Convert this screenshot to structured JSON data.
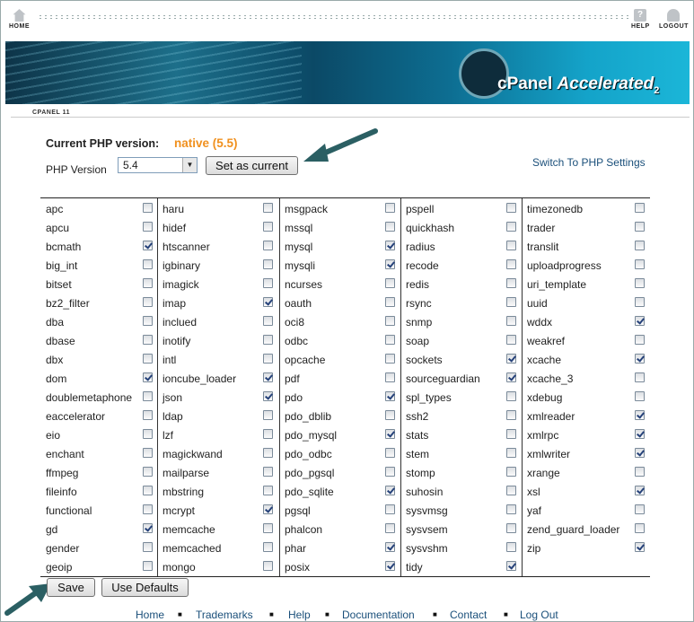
{
  "topbar": {
    "home": "HOME",
    "help": "HELP",
    "logout": "LOGOUT"
  },
  "banner": {
    "logo_cp": "cPanel",
    "logo_acc": "Accelerated",
    "logo_num": "2"
  },
  "breadcrumb": "CPANEL 11",
  "php": {
    "current_label": "Current PHP version:",
    "current_value": "native (5.5)",
    "version_label": "PHP Version",
    "version_selected": "5.4",
    "set_current_button": "Set as current",
    "switch_link": "Switch To PHP Settings"
  },
  "extensions": [
    [
      {
        "name": "apc",
        "checked": false
      },
      {
        "name": "apcu",
        "checked": false
      },
      {
        "name": "bcmath",
        "checked": true
      },
      {
        "name": "big_int",
        "checked": false
      },
      {
        "name": "bitset",
        "checked": false
      },
      {
        "name": "bz2_filter",
        "checked": false
      },
      {
        "name": "dba",
        "checked": false
      },
      {
        "name": "dbase",
        "checked": false
      },
      {
        "name": "dbx",
        "checked": false
      },
      {
        "name": "dom",
        "checked": true
      },
      {
        "name": "doublemetaphone",
        "checked": false
      },
      {
        "name": "eaccelerator",
        "checked": false
      },
      {
        "name": "eio",
        "checked": false
      },
      {
        "name": "enchant",
        "checked": false
      },
      {
        "name": "ffmpeg",
        "checked": false
      },
      {
        "name": "fileinfo",
        "checked": false
      },
      {
        "name": "functional",
        "checked": false
      },
      {
        "name": "gd",
        "checked": true
      },
      {
        "name": "gender",
        "checked": false
      },
      {
        "name": "geoip",
        "checked": false
      }
    ],
    [
      {
        "name": "haru",
        "checked": false
      },
      {
        "name": "hidef",
        "checked": false
      },
      {
        "name": "htscanner",
        "checked": false
      },
      {
        "name": "igbinary",
        "checked": false
      },
      {
        "name": "imagick",
        "checked": false
      },
      {
        "name": "imap",
        "checked": true
      },
      {
        "name": "inclued",
        "checked": false
      },
      {
        "name": "inotify",
        "checked": false
      },
      {
        "name": "intl",
        "checked": false
      },
      {
        "name": "ioncube_loader",
        "checked": true
      },
      {
        "name": "json",
        "checked": true
      },
      {
        "name": "ldap",
        "checked": false
      },
      {
        "name": "lzf",
        "checked": false
      },
      {
        "name": "magickwand",
        "checked": false
      },
      {
        "name": "mailparse",
        "checked": false
      },
      {
        "name": "mbstring",
        "checked": false
      },
      {
        "name": "mcrypt",
        "checked": true
      },
      {
        "name": "memcache",
        "checked": false
      },
      {
        "name": "memcached",
        "checked": false
      },
      {
        "name": "mongo",
        "checked": false
      }
    ],
    [
      {
        "name": "msgpack",
        "checked": false
      },
      {
        "name": "mssql",
        "checked": false
      },
      {
        "name": "mysql",
        "checked": true
      },
      {
        "name": "mysqli",
        "checked": true
      },
      {
        "name": "ncurses",
        "checked": false
      },
      {
        "name": "oauth",
        "checked": false
      },
      {
        "name": "oci8",
        "checked": false
      },
      {
        "name": "odbc",
        "checked": false
      },
      {
        "name": "opcache",
        "checked": false
      },
      {
        "name": "pdf",
        "checked": false
      },
      {
        "name": "pdo",
        "checked": true
      },
      {
        "name": "pdo_dblib",
        "checked": false
      },
      {
        "name": "pdo_mysql",
        "checked": true
      },
      {
        "name": "pdo_odbc",
        "checked": false
      },
      {
        "name": "pdo_pgsql",
        "checked": false
      },
      {
        "name": "pdo_sqlite",
        "checked": true
      },
      {
        "name": "pgsql",
        "checked": false
      },
      {
        "name": "phalcon",
        "checked": false
      },
      {
        "name": "phar",
        "checked": true
      },
      {
        "name": "posix",
        "checked": true
      }
    ],
    [
      {
        "name": "pspell",
        "checked": false
      },
      {
        "name": "quickhash",
        "checked": false
      },
      {
        "name": "radius",
        "checked": false
      },
      {
        "name": "recode",
        "checked": false
      },
      {
        "name": "redis",
        "checked": false
      },
      {
        "name": "rsync",
        "checked": false
      },
      {
        "name": "snmp",
        "checked": false
      },
      {
        "name": "soap",
        "checked": false
      },
      {
        "name": "sockets",
        "checked": true
      },
      {
        "name": "sourceguardian",
        "checked": true
      },
      {
        "name": "spl_types",
        "checked": false
      },
      {
        "name": "ssh2",
        "checked": false
      },
      {
        "name": "stats",
        "checked": false
      },
      {
        "name": "stem",
        "checked": false
      },
      {
        "name": "stomp",
        "checked": false
      },
      {
        "name": "suhosin",
        "checked": false
      },
      {
        "name": "sysvmsg",
        "checked": false
      },
      {
        "name": "sysvsem",
        "checked": false
      },
      {
        "name": "sysvshm",
        "checked": false
      },
      {
        "name": "tidy",
        "checked": true
      }
    ],
    [
      {
        "name": "timezonedb",
        "checked": false
      },
      {
        "name": "trader",
        "checked": false
      },
      {
        "name": "translit",
        "checked": false
      },
      {
        "name": "uploadprogress",
        "checked": false
      },
      {
        "name": "uri_template",
        "checked": false
      },
      {
        "name": "uuid",
        "checked": false
      },
      {
        "name": "wddx",
        "checked": true
      },
      {
        "name": "weakref",
        "checked": false
      },
      {
        "name": "xcache",
        "checked": true
      },
      {
        "name": "xcache_3",
        "checked": false
      },
      {
        "name": "xdebug",
        "checked": false
      },
      {
        "name": "xmlreader",
        "checked": true
      },
      {
        "name": "xmlrpc",
        "checked": true
      },
      {
        "name": "xmlwriter",
        "checked": true
      },
      {
        "name": "xrange",
        "checked": false
      },
      {
        "name": "xsl",
        "checked": true
      },
      {
        "name": "yaf",
        "checked": false
      },
      {
        "name": "zend_guard_loader",
        "checked": false
      },
      {
        "name": "zip",
        "checked": true
      }
    ]
  ],
  "buttons": {
    "save": "Save",
    "defaults": "Use Defaults"
  },
  "footer": {
    "links": [
      "Home",
      "Trademarks",
      "Help",
      "Documentation",
      "Contact",
      "Log Out"
    ],
    "separator": "■"
  },
  "colors": {
    "accent_orange": "#f0901e",
    "link_blue": "#1a4f7a",
    "arrow_teal": "#2b5f63"
  }
}
